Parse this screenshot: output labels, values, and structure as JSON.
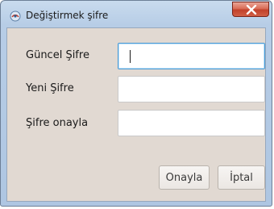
{
  "window": {
    "title": "Değiştirmek şifre",
    "close_glyph": "X"
  },
  "form": {
    "current_password_label": "Güncel Şifre",
    "current_password_value": "",
    "new_password_label": "Yeni Şifre",
    "new_password_value": "",
    "confirm_password_label": "Şifre onayla",
    "confirm_password_value": ""
  },
  "buttons": {
    "confirm_label": "Onayla",
    "cancel_label": "İptal"
  },
  "icons": {
    "app": "java-app-icon",
    "close": "close-icon"
  },
  "colors": {
    "titlebar": "#b7cde6",
    "client_bg": "#e1d9d2",
    "close_button": "#c2412a",
    "focus_border": "#4a9bd6"
  }
}
